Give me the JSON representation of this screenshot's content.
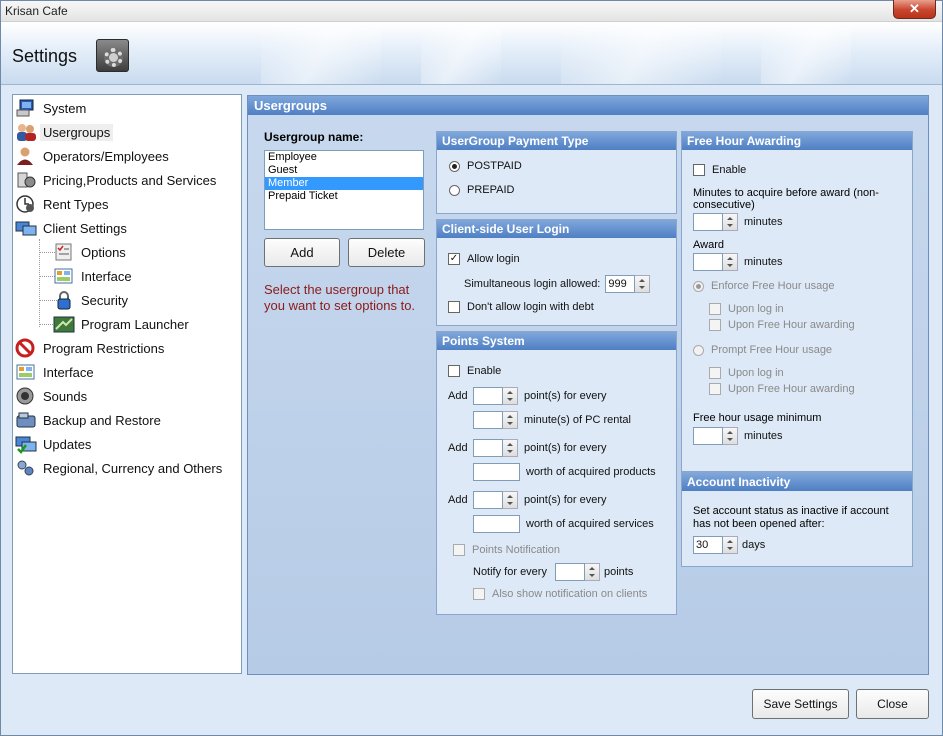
{
  "window": {
    "title": "Krisan Cafe",
    "close_glyph": "✕"
  },
  "header": {
    "title": "Settings",
    "icon": "gear-icon"
  },
  "sidebar": {
    "items": [
      {
        "label": "System",
        "icon": "monitor-icon"
      },
      {
        "label": "Usergroups",
        "icon": "users-icon",
        "selected": true
      },
      {
        "label": "Operators/Employees",
        "icon": "operator-icon"
      },
      {
        "label": "Pricing,Products and Services",
        "icon": "pricing-icon"
      },
      {
        "label": "Rent Types",
        "icon": "clock-icon"
      },
      {
        "label": "Client Settings",
        "icon": "client-icon"
      },
      {
        "label": "Options",
        "icon": "checklist-icon"
      },
      {
        "label": "Interface",
        "icon": "interface-icon"
      },
      {
        "label": "Security",
        "icon": "lock-icon"
      },
      {
        "label": "Program Launcher",
        "icon": "launcher-icon"
      },
      {
        "label": "Program Restrictions",
        "icon": "no-entry-icon"
      },
      {
        "label": "Interface",
        "icon": "interface-icon"
      },
      {
        "label": "Sounds",
        "icon": "speaker-icon"
      },
      {
        "label": "Backup and Restore",
        "icon": "backup-icon"
      },
      {
        "label": "Updates",
        "icon": "updates-icon"
      },
      {
        "label": "Regional, Currency and Others",
        "icon": "regional-icon"
      }
    ]
  },
  "main": {
    "title": "Usergroups",
    "group_label": "Usergroup name:",
    "groups": [
      "Employee",
      "Guest",
      "Member",
      "Prepaid Ticket"
    ],
    "selected_group": "Member",
    "add_label": "Add",
    "delete_label": "Delete",
    "hint": "Select the usergroup that you want to set options to."
  },
  "payment": {
    "title": "UserGroup Payment Type",
    "postpaid": "POSTPAID",
    "prepaid": "PREPAID",
    "selected": "POSTPAID"
  },
  "login": {
    "title": "Client-side User Login",
    "allow": "Allow login",
    "simultaneous": "Simultaneous login allowed:",
    "simultaneous_value": "999",
    "debt": "Don't allow login with debt"
  },
  "points": {
    "title": "Points System",
    "enable": "Enable",
    "add": "Add",
    "points_for_every": "point(s) for every",
    "minutes_pc": "minute(s) of PC rental",
    "acquired_products": "worth of acquired products",
    "acquired_services": "worth of acquired services",
    "notification": "Points Notification",
    "notify_every": "Notify for every",
    "points_unit": "points",
    "also_show": "Also show notification on clients"
  },
  "freehour": {
    "title": "Free Hour Awarding",
    "enable": "Enable",
    "minutes_acquire": "Minutes to acquire before award (non-consecutive)",
    "minutes": "minutes",
    "award": "Award",
    "enforce": "Enforce Free Hour usage",
    "upon_login": "Upon log in",
    "upon_award": "Upon Free Hour awarding",
    "prompt": "Prompt Free Hour usage",
    "min_usage": "Free hour usage minimum"
  },
  "inactivity": {
    "title": "Account Inactivity",
    "text": "Set account status as inactive if account has not been opened after:",
    "days_value": "30",
    "days": "days"
  },
  "footer": {
    "save": "Save Settings",
    "close": "Close"
  }
}
